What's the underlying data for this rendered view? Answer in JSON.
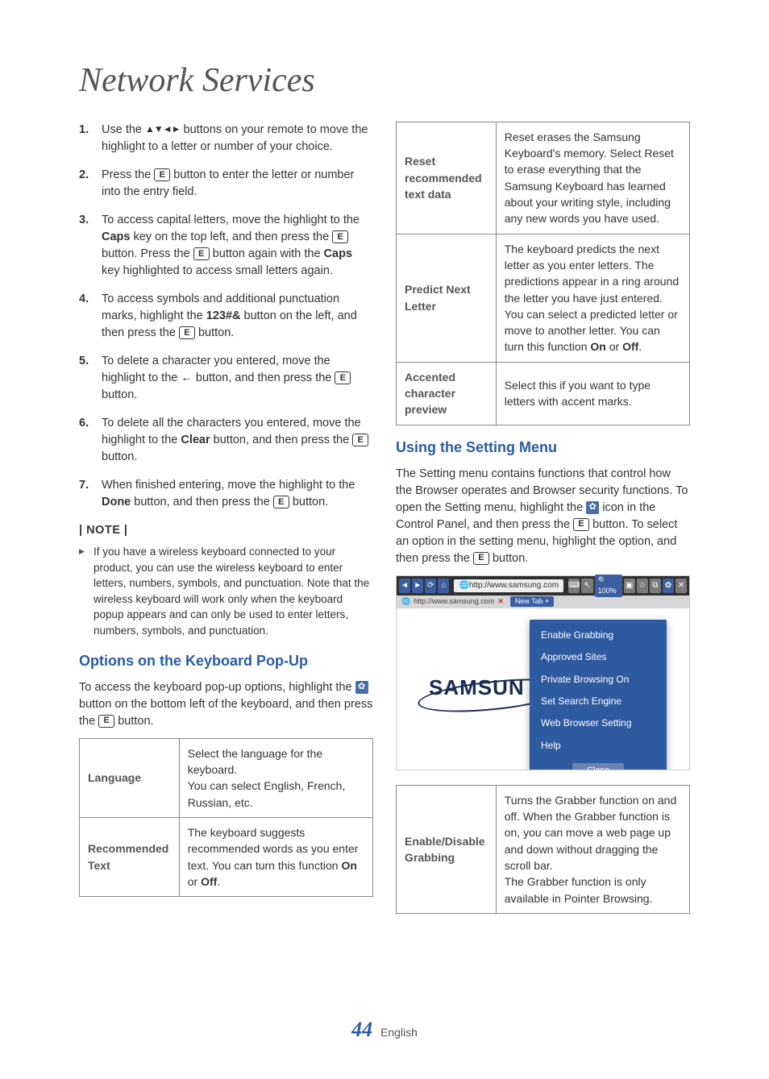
{
  "title": "Network Services",
  "steps": [
    "Use the ▲▼◄► buttons on your remote to move the highlight to a letter or number of your choice.",
    "Press the [E] button to enter the letter or number into the entry field.",
    "To access capital letters, move the highlight to the Caps key on the top left, and then press the [E] button. Press the [E] button again with the Caps key highlighted to access small letters again.",
    "To access symbols and additional punctuation marks, highlight the 123#& button on the left, and then press the [E] button.",
    "To delete a character you entered, move the highlight to the ← button, and then press the [E] button.",
    "To delete all the characters you entered, move the highlight to the Clear button, and then press the [E] button.",
    "When finished entering, move the highlight to the Done button, and then press the [E] button."
  ],
  "note_label": "| NOTE |",
  "note": "If you have a wireless keyboard connected to your product, you can use the wireless keyboard to enter letters, numbers, symbols, and punctuation. Note that the wireless keyboard will work only when the keyboard popup appears and can only be used to enter letters, numbers, symbols, and punctuation.",
  "left_heading": "Options on the Keyboard Pop-Up",
  "left_intro": "To access the keyboard pop-up options, highlight the ⚙ button on the bottom left of the keyboard, and then press the [E] button.",
  "left_table": [
    {
      "k": "Language",
      "v": "Select the language for the keyboard.\nYou can select English, French, Russian, etc."
    },
    {
      "k": "Recommended Text",
      "v": "The keyboard suggests recommended words as you enter text. You can turn this function On or Off."
    }
  ],
  "right_table": [
    {
      "k": "Reset recommended text data",
      "v": "Reset erases the Samsung Keyboard's memory. Select Reset to erase everything that the Samsung Keyboard has learned about your writing style, including any new words you have used."
    },
    {
      "k": "Predict Next Letter",
      "v": "The keyboard predicts the next letter as you enter letters. The predictions appear in a ring around the letter you have just entered. You can select a predicted letter or move to another letter. You can turn this function On or Off."
    },
    {
      "k": "Accented character preview",
      "v": "Select this if you want to type letters with accent marks."
    }
  ],
  "right_heading": "Using the Setting Menu",
  "right_intro": "The Setting menu contains functions that control how the Browser operates and Browser security functions. To open the Setting menu, highlight the ⚙ icon in the Control Panel, and then press the [E] button. To select an option in the setting menu, highlight the option, and then press the [E] button.",
  "browser": {
    "url": "http://www.samsung.com",
    "tab_url": "http://www.samsung.com",
    "zoom": "100%",
    "logo": "SAMSUN",
    "new_tab": "New Tab",
    "menu": [
      "Enable Grabbing",
      "Approved Sites",
      "Private Browsing On",
      "Set Search Engine",
      "Web Browser Setting",
      "Help"
    ],
    "close": "Close"
  },
  "grab_table": [
    {
      "k": "Enable/Disable Grabbing",
      "v": "Turns the Grabber function on and off. When the Grabber function is on, you can move a web page up and down without dragging the scroll bar.\nThe Grabber function is only available in Pointer Browsing."
    }
  ],
  "footer": {
    "page": "44",
    "lang": "English"
  }
}
